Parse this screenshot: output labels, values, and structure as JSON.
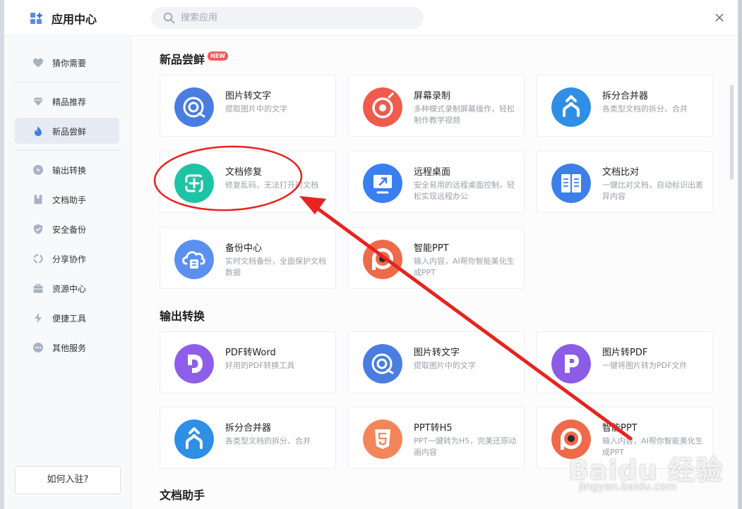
{
  "window": {
    "title": "应用中心"
  },
  "search": {
    "placeholder": "搜索应用"
  },
  "sidebar": {
    "items": [
      {
        "label": "猜你需要",
        "icon": "heart-icon"
      },
      {
        "label": "精品推荐",
        "icon": "gem-icon"
      },
      {
        "label": "新品尝鲜",
        "icon": "flame-icon",
        "active": true
      },
      {
        "label": "输出转换",
        "icon": "convert-icon"
      },
      {
        "label": "文档助手",
        "icon": "doc-icon"
      },
      {
        "label": "安全备份",
        "icon": "shield-icon"
      },
      {
        "label": "分享协作",
        "icon": "share-icon"
      },
      {
        "label": "资源中心",
        "icon": "briefcase-icon"
      },
      {
        "label": "便捷工具",
        "icon": "bolt-icon"
      },
      {
        "label": "其他服务",
        "icon": "more-icon"
      }
    ],
    "join_label": "如何入驻?"
  },
  "sections": {
    "new": {
      "title": "新品尝鲜",
      "badge": "NEW",
      "cards": [
        {
          "name": "图片转文字",
          "desc": "提取图片中的文字",
          "color": "#4a7de0"
        },
        {
          "name": "屏幕录制",
          "desc": "多种模式录制屏幕操作，轻松制作教学视频",
          "color": "#ef5b4d"
        },
        {
          "name": "拆分合并器",
          "desc": "各类型文档的拆分、合并",
          "color": "#2e8fe5"
        },
        {
          "name": "文档修复",
          "desc": "修复乱码、无法打开的文档",
          "color": "#1fc3a5"
        },
        {
          "name": "远程桌面",
          "desc": "安全易用的远程桌面控制，轻松实现远程办公",
          "color": "#3a7ff0"
        },
        {
          "name": "文档比对",
          "desc": "一键比对文档，自动标识出差异内容",
          "color": "#3d7fe8"
        },
        {
          "name": "备份中心",
          "desc": "实时文档备份，全面保护文档数据",
          "color": "#5b8ff0"
        },
        {
          "name": "智能PPT",
          "desc": "输入内容，AI帮你智能美化生成PPT",
          "color": "#ef6a4a"
        }
      ]
    },
    "output": {
      "title": "输出转换",
      "cards": [
        {
          "name": "PDF转Word",
          "desc": "好用的PDF转换工具",
          "color": "#8e5ee8"
        },
        {
          "name": "图片转文字",
          "desc": "提取图片中的文字",
          "color": "#4a7de0"
        },
        {
          "name": "图片转PDF",
          "desc": "一键将图片转为PDF文件",
          "color": "#8b5ce6"
        },
        {
          "name": "拆分合并器",
          "desc": "各类型文档的拆分、合并",
          "color": "#2e8fe5"
        },
        {
          "name": "PPT转H5",
          "desc": "PPT一键转为H5，完美还原动画内容",
          "color": "#f2865a"
        },
        {
          "name": "智能PPT",
          "desc": "输入内容，AI帮你智能美化生成PPT",
          "color": "#ef6a4a"
        }
      ]
    },
    "docs": {
      "title": "文档助手"
    }
  },
  "watermark": {
    "brand": "Baidu 经验",
    "url": "jingyan.baidu.com"
  },
  "annotation_color": "#e8231f"
}
